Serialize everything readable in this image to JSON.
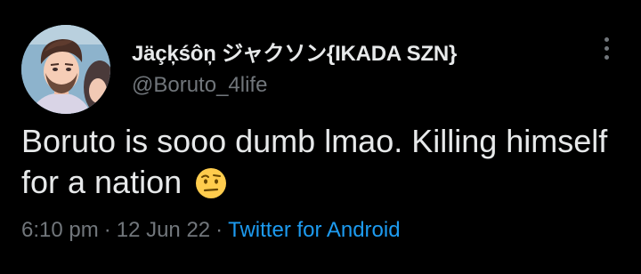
{
  "tweet": {
    "author": {
      "display_name": "Jäçķśôņ ジャクソン{IKADA SZN}",
      "handle": "@Boruto_4life"
    },
    "text": "Boruto is sooo dumb lmao. Killing himself for a nation",
    "emoji": "face-with-raised-eyebrow",
    "time": "6:10 pm",
    "separator": "·",
    "date": "12 Jun 22",
    "source": "Twitter for Android"
  },
  "colors": {
    "background": "#000000",
    "primary_text": "#e7e9ea",
    "secondary_text": "#71767b",
    "link": "#1d9bf0"
  }
}
